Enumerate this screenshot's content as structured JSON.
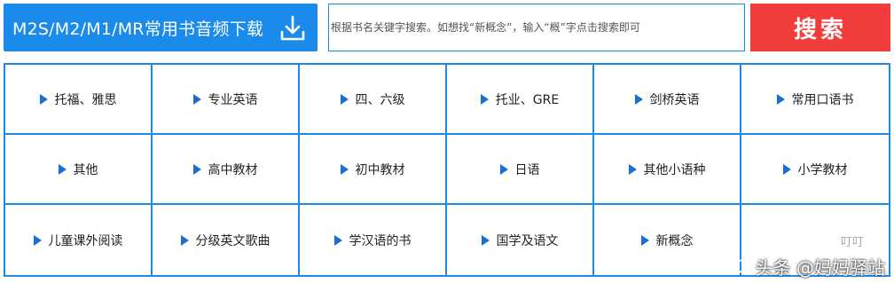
{
  "download": {
    "label": "M2S/M2/M1/MR常用书音频下载",
    "icon": "download-icon"
  },
  "search": {
    "placeholder": "根据书名关键字搜索。如想找“新概念”，输入“概”字点击搜索即可",
    "button_label": "搜索"
  },
  "categories": [
    {
      "label": "托福、雅思"
    },
    {
      "label": "专业英语"
    },
    {
      "label": "四、六级"
    },
    {
      "label": "托业、GRE"
    },
    {
      "label": "剑桥英语"
    },
    {
      "label": "常用口语书"
    },
    {
      "label": "其他"
    },
    {
      "label": "高中教材"
    },
    {
      "label": "初中教材"
    },
    {
      "label": "日语"
    },
    {
      "label": "其他小语种"
    },
    {
      "label": "小学教材"
    },
    {
      "label": "儿童课外阅读"
    },
    {
      "label": "分级英文歌曲"
    },
    {
      "label": "学汉语的书"
    },
    {
      "label": "国学及语文"
    },
    {
      "label": "新概念"
    },
    {
      "label": ""
    }
  ],
  "watermark": {
    "text": "头条 @妈妈驿站",
    "faint_text": "叮叮"
  },
  "colors": {
    "accent_blue": "#1a8bea",
    "search_red": "#f23d3d",
    "triangle_blue": "#1a6fd0"
  }
}
